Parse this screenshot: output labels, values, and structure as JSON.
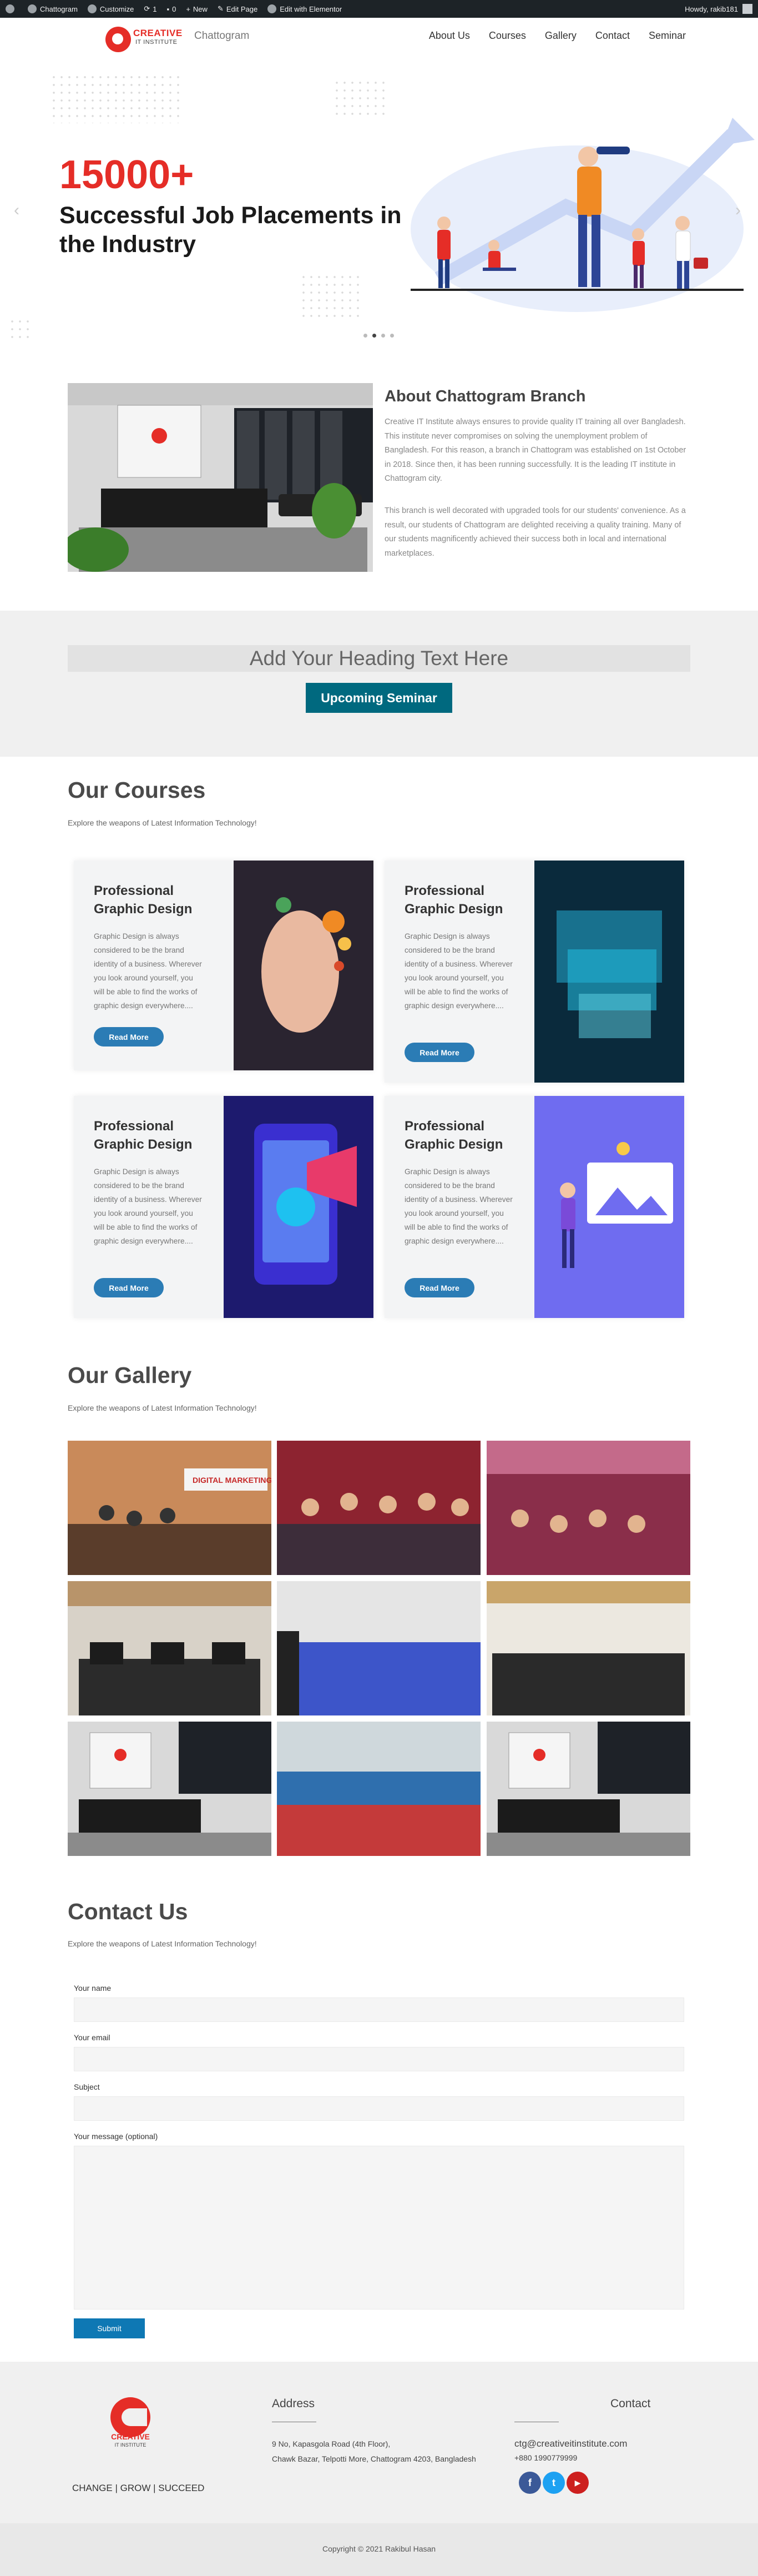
{
  "adminbar": {
    "site_name": "Chattogram",
    "customize": "Customize",
    "updates": "1",
    "comments": "0",
    "new": "New",
    "edit_page": "Edit Page",
    "edit_elementor": "Edit with Elementor",
    "howdy": "Howdy, rakib181"
  },
  "header": {
    "logo_name": "CREATIVE",
    "logo_sub": "IT INSTITUTE",
    "city": "Chattogram",
    "nav": [
      "About Us",
      "Courses",
      "Gallery",
      "Contact",
      "Seminar"
    ]
  },
  "hero": {
    "headline_number": "15000+",
    "headline_text": "Successful Job Placements in the Industry",
    "slide_count": 4,
    "active_slide": 2
  },
  "about": {
    "title": "About Chattogram Branch",
    "paragraph1": "Creative IT Institute always ensures to provide quality IT training all over Bangladesh. This institute never compromises on solving the unemployment problem of Bangladesh. For this reason, a branch in Chattogram was established on 1st October in 2018. Since then, it has been running successfully. It is the leading IT institute in Chattogram city.",
    "paragraph2": "This branch is well decorated with upgraded tools for our students' convenience. As a result, our students of Chattogram are delighted receiving a quality training. Many of our students magnificently achieved their success both in local and international marketplaces."
  },
  "seminar": {
    "heading": "Add Your Heading Text Here",
    "button": "Upcoming Seminar"
  },
  "courses": {
    "title": "Our Courses",
    "subtitle": "Explore the weapons of Latest Information Technology!",
    "items": [
      {
        "title": "Professional Graphic Design",
        "text": "Graphic Design is always considered to be the brand identity of a business. Wherever you look around yourself, you will be able to find the works of graphic design everywhere....",
        "button": "Read More"
      },
      {
        "title": "Professional Graphic Design",
        "text": "Graphic Design is always considered to be the brand identity of a business. Wherever you look around yourself, you will be able to find the works of graphic design everywhere....",
        "button": "Read More"
      },
      {
        "title": "Professional Graphic Design",
        "text": "Graphic Design is always considered to be the brand identity of a business. Wherever you look around yourself, you will be able to find the works of graphic design everywhere....",
        "button": "Read More"
      },
      {
        "title": "Professional Graphic Design",
        "text": "Graphic Design is always considered to be the brand identity of a business. Wherever you look around yourself, you will be able to find the works of graphic design everywhere....",
        "button": "Read More"
      }
    ]
  },
  "gallery": {
    "title": "Our Gallery",
    "subtitle": "Explore the weapons of Latest Information Technology!",
    "banner_text": "DIGITAL MARKETING"
  },
  "contact": {
    "title": "Contact Us",
    "subtitle": "Explore the weapons of Latest Information Technology!",
    "fields": [
      "Your name",
      "Your email",
      "Subject",
      "Your message (optional)"
    ],
    "submit": "Submit"
  },
  "footer": {
    "tagline": "CHANGE | GROW | SUCCEED",
    "address_title": "Address",
    "address_line1": "9 No, Kapasgola Road (4th Floor),",
    "address_line2": "Chawk Bazar, Telpotti More, Chattogram 4203, Bangladesh",
    "contact_title": "Contact",
    "email": "ctg@creativeitinstitute.com",
    "phone": "+880 1990779999",
    "social": [
      "f",
      "t",
      "▶"
    ],
    "copyright": "Copyright © 2021 Rakibul Hasan"
  },
  "colors": {
    "brand_red": "#e52d27",
    "seminar_button": "#00697f",
    "read_more": "#2b7cb5",
    "submit": "#0e78b4",
    "facebook": "#3b5998",
    "twitter": "#1da1f2",
    "youtube": "#cd201f"
  }
}
